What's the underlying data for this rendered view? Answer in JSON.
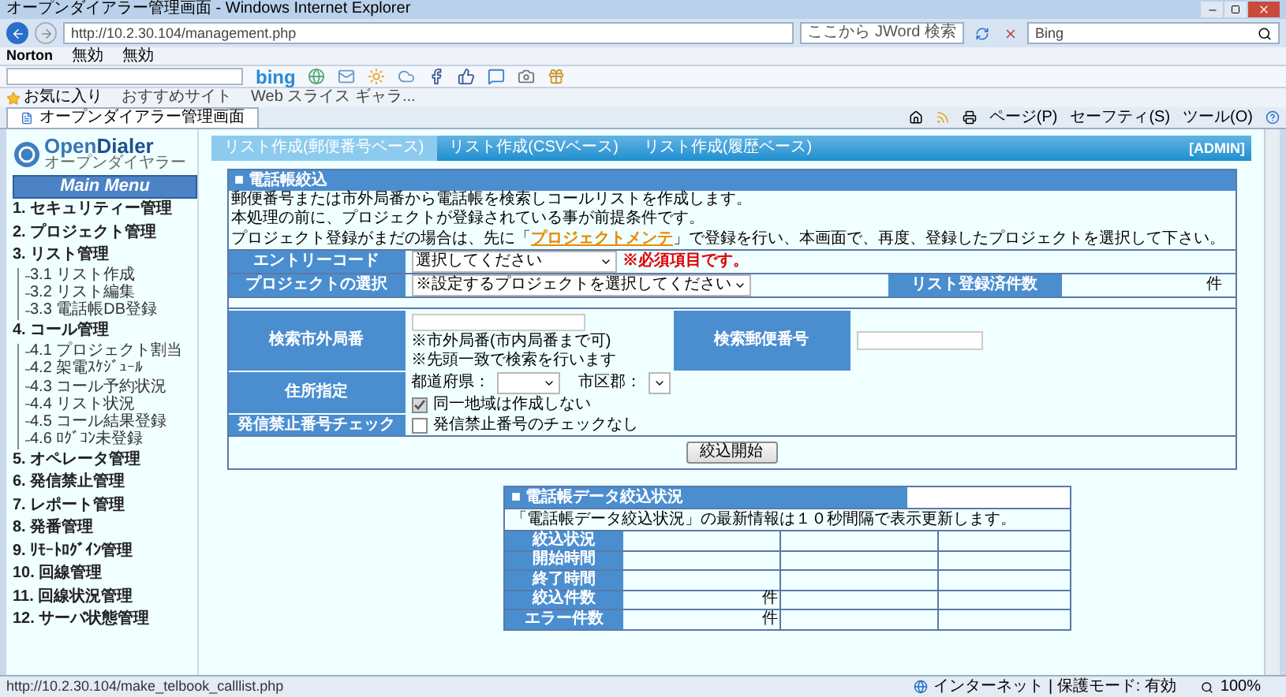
{
  "window": {
    "title": "オープンダイアラー管理画面 - Windows Internet Explorer"
  },
  "address_bar": {
    "url": "http://10.2.30.104/management.php",
    "search_placeholder": "ここから JWord 検索",
    "search_provider": "Bing"
  },
  "norton_bar": {
    "brand": "Norton",
    "items": [
      "無効",
      "無効"
    ]
  },
  "bing_bar": {
    "logo": "bing"
  },
  "favorites_bar": {
    "favorites": "お気に入り",
    "links": [
      "おすすめサイト",
      "Web スライス ギャラ..."
    ]
  },
  "tabs": [
    {
      "label": "オープンダイアラー管理画面",
      "selected": true
    }
  ],
  "command_bar": [
    "ページ(P)",
    "セーフティ(S)",
    "ツール(O)"
  ],
  "sidebar": {
    "logo_main": "Open",
    "logo_accent": "Dialer",
    "logo_sub": "オープンダイヤラー",
    "menu_title": "Main Menu",
    "items": [
      {
        "label": "1. セキュリティー管理"
      },
      {
        "label": "2. プロジェクト管理"
      },
      {
        "label": "3. リスト管理",
        "children": [
          {
            "label": "3.1 リスト作成"
          },
          {
            "label": "3.2 リスト編集"
          },
          {
            "label": "3.3 電話帳DB登録"
          }
        ]
      },
      {
        "label": "4. コール管理",
        "children": [
          {
            "label": "4.1 プロジェクト割当"
          },
          {
            "label": "4.2 架電ｽｹｼﾞｭｰﾙ"
          },
          {
            "label": "4.3 コール予約状況"
          },
          {
            "label": "4.4 リスト状況"
          },
          {
            "label": "4.5 コール結果登録"
          },
          {
            "label": "4.6 ﾛｸﾞｺﾝ未登録"
          }
        ]
      },
      {
        "label": "5. オペレータ管理"
      },
      {
        "label": "6. 発信禁止管理"
      },
      {
        "label": "7. レポート管理"
      },
      {
        "label": "8. 発番管理"
      },
      {
        "label": "9. ﾘﾓｰﾄﾛｸﾞｲﾝ管理"
      },
      {
        "label": "10. 回線管理"
      },
      {
        "label": "11. 回線状況管理"
      },
      {
        "label": "12. サーバ状態管理"
      }
    ]
  },
  "nav_tabs": [
    {
      "label": "リスト作成(郵便番号ベース)",
      "selected": true
    },
    {
      "label": "リスト作成(CSVベース)",
      "selected": false
    },
    {
      "label": "リスト作成(履歴ベース)",
      "selected": false
    }
  ],
  "user_badge": "[ADMIN]",
  "search_panel": {
    "title": "■ 電話帳絞込",
    "description": [
      "郵便番号または市外局番から電話帳を検索しコールリストを作成します。",
      "本処理の前に、プロジェクトが登録されている事が前提条件です。"
    ],
    "notice": {
      "before": "プロジェクト登録がまだの場合は、先に「",
      "link": "プロジェクトメンテ",
      "after": "」で登録を行い、本画面で、再度、登録したプロジェクトを選択して下さい。"
    },
    "entry_code": {
      "label": "エントリーコード",
      "value": "選択してください",
      "required_note": "※必須項目です。"
    },
    "project": {
      "label": "プロジェクトの選択",
      "value": "※設定するプロジェクトを選択してください",
      "count_label": "リスト登録済件数",
      "count_unit": "件"
    },
    "area_code": {
      "label": "検索市外局番",
      "notes": [
        "※市外局番(市内局番まで可)",
        "※先頭一致で検索を行います"
      ]
    },
    "postal_code": {
      "label": "検索郵便番号"
    },
    "address": {
      "label": "住所指定",
      "prefecture_label": "都道府県：",
      "city_label": "市区郡：",
      "same_area": {
        "label": "同一地域は作成しない",
        "checked": true
      }
    },
    "block_check": {
      "label": "発信禁止番号チェック",
      "option": {
        "label": "発信禁止番号のチェックなし",
        "checked": false
      }
    },
    "submit": "絞込開始"
  },
  "status_panel": {
    "title": "■ 電話帳データ絞込状況",
    "note": "「電話帳データ絞込状況」の最新情報は１０秒間隔で表示更新します。",
    "rows": [
      {
        "label": "絞込状況"
      },
      {
        "label": "開始時間"
      },
      {
        "label": "終了時間"
      },
      {
        "label": "絞込件数",
        "unit": "件"
      },
      {
        "label": "エラー件数",
        "unit": "件"
      }
    ]
  },
  "status_bar": {
    "url": "http://10.2.30.104/make_telbook_calllist.php",
    "zone": "インターネット | 保護モード: 有効",
    "zoom": "100%"
  }
}
